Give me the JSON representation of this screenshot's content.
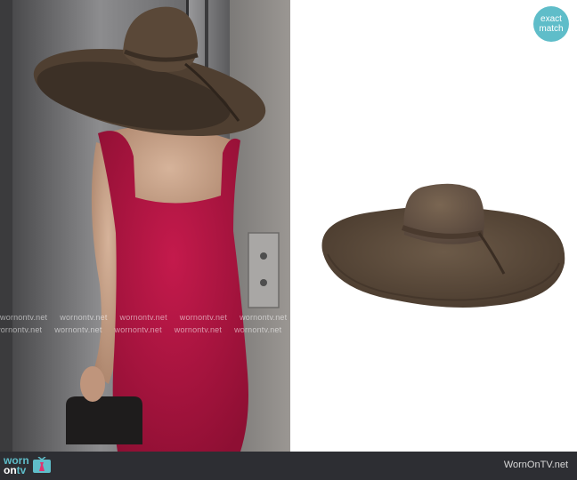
{
  "badge": {
    "line1": "exact",
    "line2": "match"
  },
  "watermark": {
    "text": "wornontv.net"
  },
  "footer": {
    "logo_worn": "worn",
    "logo_on": "on",
    "logo_tv": "tv",
    "site": "WornOnTV.net"
  },
  "colors": {
    "badge": "#5fbdc9",
    "footer_bg": "#2d2e33",
    "dress": "#b3143f",
    "hat": "#5b4a3a"
  }
}
